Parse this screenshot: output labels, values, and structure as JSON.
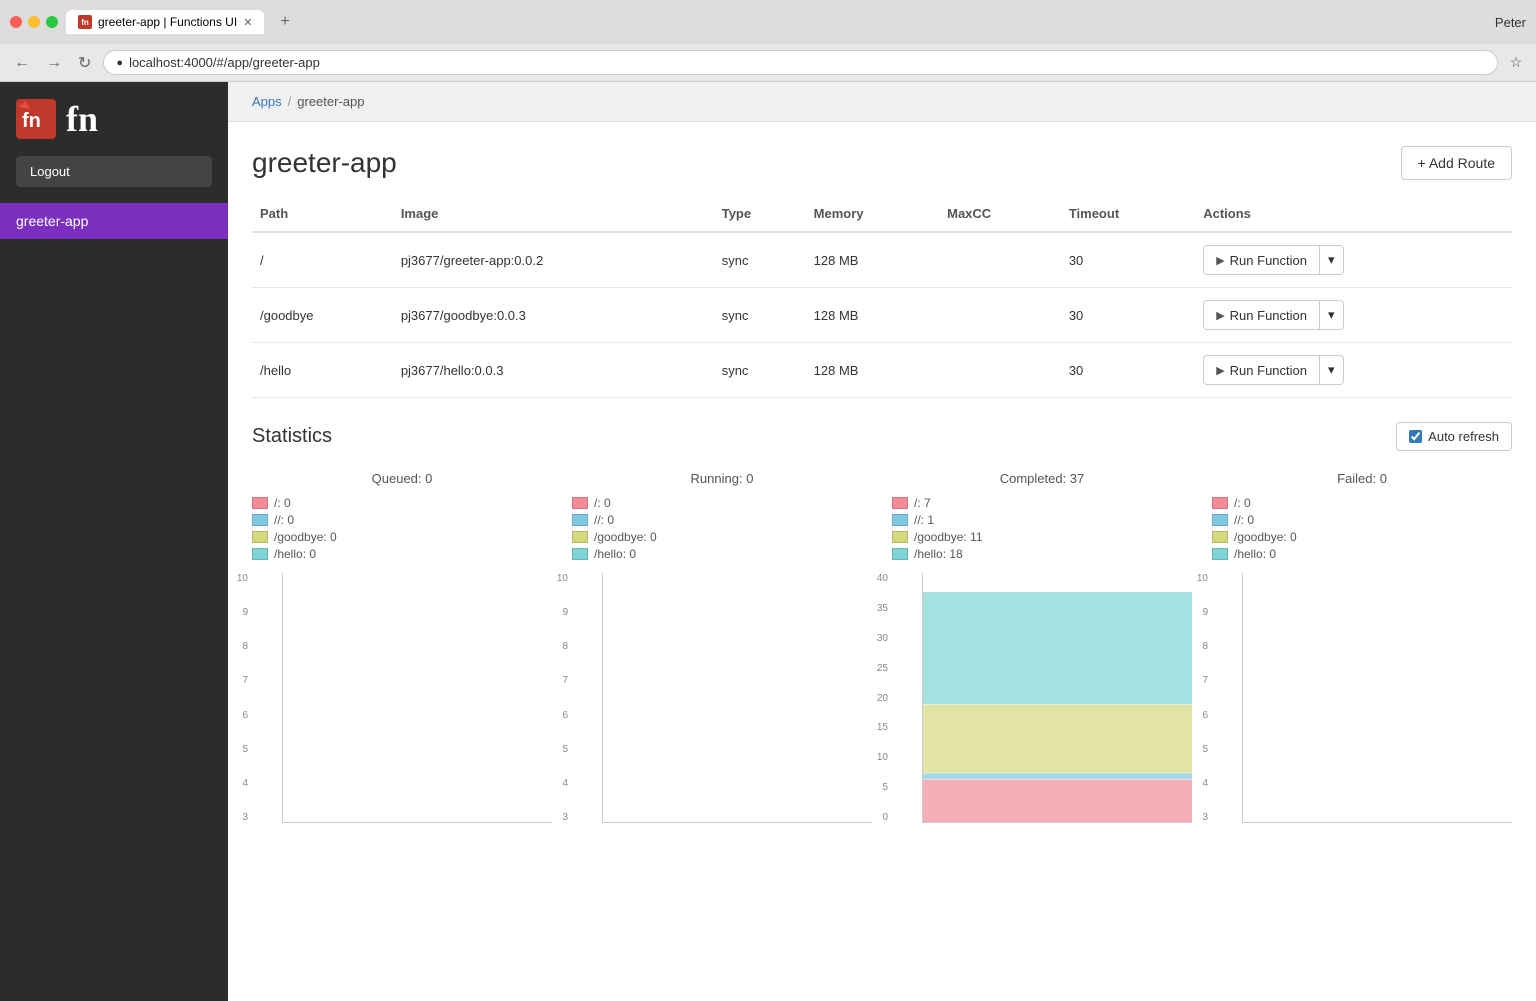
{
  "browser": {
    "tab_title": "greeter-app | Functions UI",
    "url": "localhost:4000/#/app/greeter-app",
    "user": "Peter",
    "new_tab_icon": "+"
  },
  "sidebar": {
    "logo_text": "fn",
    "logout_label": "Logout",
    "items": [
      {
        "label": "greeter-app",
        "active": true
      }
    ]
  },
  "breadcrumb": {
    "apps_label": "Apps",
    "separator": "/",
    "current": "greeter-app"
  },
  "page": {
    "title": "greeter-app",
    "add_route_label": "+ Add Route"
  },
  "table": {
    "headers": [
      "Path",
      "Image",
      "Type",
      "Memory",
      "MaxCC",
      "Timeout",
      "Actions"
    ],
    "rows": [
      {
        "path": "/",
        "image": "pj3677/greeter-app:0.0.2",
        "type": "sync",
        "memory": "128 MB",
        "maxcc": "",
        "timeout": "30"
      },
      {
        "path": "/goodbye",
        "image": "pj3677/goodbye:0.0.3",
        "type": "sync",
        "memory": "128 MB",
        "maxcc": "",
        "timeout": "30"
      },
      {
        "path": "/hello",
        "image": "pj3677/hello:0.0.3",
        "type": "sync",
        "memory": "128 MB",
        "maxcc": "",
        "timeout": "30"
      }
    ],
    "run_function_label": "Run Function"
  },
  "statistics": {
    "title": "Statistics",
    "auto_refresh_label": "Auto refresh",
    "charts": [
      {
        "title": "Queued: 0",
        "legend": [
          {
            "label": "/: 0",
            "color": "#f28b97"
          },
          {
            "label": "//: 0",
            "color": "#7ec8e3"
          },
          {
            "label": "/goodbye: 0",
            "color": "#d4d97e"
          },
          {
            "label": "/hello: 0",
            "color": "#7dd4d4"
          }
        ],
        "y_max": 10,
        "y_labels": [
          "10",
          "9",
          "8",
          "7",
          "6",
          "5",
          "4",
          "3"
        ],
        "has_data": false
      },
      {
        "title": "Running: 0",
        "legend": [
          {
            "label": "/: 0",
            "color": "#f28b97"
          },
          {
            "label": "//: 0",
            "color": "#7ec8e3"
          },
          {
            "label": "/goodbye: 0",
            "color": "#d4d97e"
          },
          {
            "label": "/hello: 0",
            "color": "#7dd4d4"
          }
        ],
        "y_max": 10,
        "y_labels": [
          "10",
          "9",
          "8",
          "7",
          "6",
          "5",
          "4",
          "3"
        ],
        "has_data": false
      },
      {
        "title": "Completed: 37",
        "legend": [
          {
            "label": "/: 7",
            "color": "#f28b97"
          },
          {
            "label": "//: 1",
            "color": "#7ec8e3"
          },
          {
            "label": "/goodbye: 11",
            "color": "#d4d97e"
          },
          {
            "label": "/hello: 18",
            "color": "#7dd4d4"
          }
        ],
        "y_max": 40,
        "y_labels": [
          "40",
          "35",
          "30",
          "25",
          "20",
          "15",
          "10",
          "5",
          "0"
        ],
        "has_data": true,
        "stacked_values": [
          7,
          1,
          11,
          18
        ]
      },
      {
        "title": "Failed: 0",
        "legend": [
          {
            "label": "/: 0",
            "color": "#f28b97"
          },
          {
            "label": "//: 0",
            "color": "#7ec8e3"
          },
          {
            "label": "/goodbye: 0",
            "color": "#d4d97e"
          },
          {
            "label": "/hello: 0",
            "color": "#7dd4d4"
          }
        ],
        "y_max": 10,
        "y_labels": [
          "10",
          "9",
          "8",
          "7",
          "6",
          "5",
          "4",
          "3"
        ],
        "has_data": false
      }
    ]
  }
}
